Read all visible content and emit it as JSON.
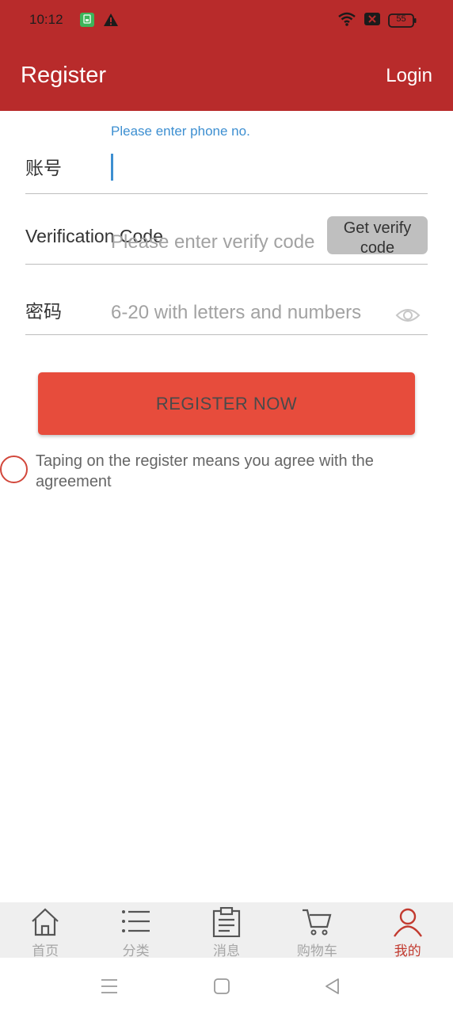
{
  "status_bar": {
    "time": "10:12",
    "battery": "55",
    "icons": [
      "sim-icon",
      "warning-icon",
      "wifi-icon",
      "no-signal-icon",
      "battery-icon"
    ]
  },
  "header": {
    "title": "Register",
    "login_label": "Login"
  },
  "form": {
    "phone": {
      "hint": "Please enter phone no.",
      "label": "账号",
      "value": "",
      "placeholder": ""
    },
    "verify": {
      "label": "Verification Code",
      "placeholder": "Please enter verify code",
      "button_label": "Get verify code"
    },
    "password": {
      "label": "密码",
      "placeholder": "6-20 with letters and numbers"
    }
  },
  "register_button": {
    "label": "REGISTER NOW"
  },
  "agreement": {
    "text": "Taping on the register means you agree with the agreement"
  },
  "tab_bar": {
    "tabs": [
      {
        "label": "首页",
        "icon": "home-icon",
        "active": false
      },
      {
        "label": "分类",
        "icon": "list-icon",
        "active": false
      },
      {
        "label": "消息",
        "icon": "clipboard-icon",
        "active": false
      },
      {
        "label": "购物车",
        "icon": "cart-icon",
        "active": false
      },
      {
        "label": "我的",
        "icon": "user-icon",
        "active": true
      }
    ]
  },
  "colors": {
    "header": "#b82b2b",
    "accent": "#e74c3c",
    "hint": "#3d8fd1",
    "active_tab": "#c23a2f"
  }
}
